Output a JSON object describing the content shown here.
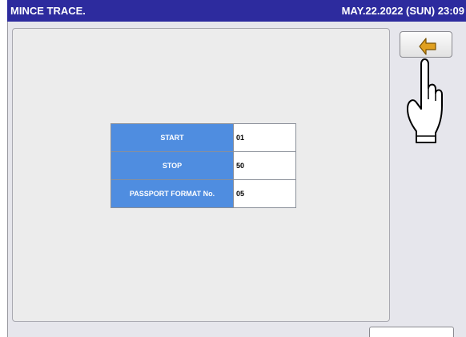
{
  "header": {
    "title": "MINCE TRACE.",
    "datetime": "MAY.22.2022 (SUN) 23:09"
  },
  "settings": [
    {
      "label": "START",
      "value": "01"
    },
    {
      "label": "STOP",
      "value": "50"
    },
    {
      "label": "PASSPORT FORMAT No.",
      "value": "05"
    }
  ],
  "icons": {
    "back": "return-arrow-icon",
    "pointer": "hand-pointer-icon"
  },
  "colors": {
    "titlebar": "#2d2b9e",
    "label_cell": "#4f8de0",
    "arrow": "#e0a020"
  }
}
